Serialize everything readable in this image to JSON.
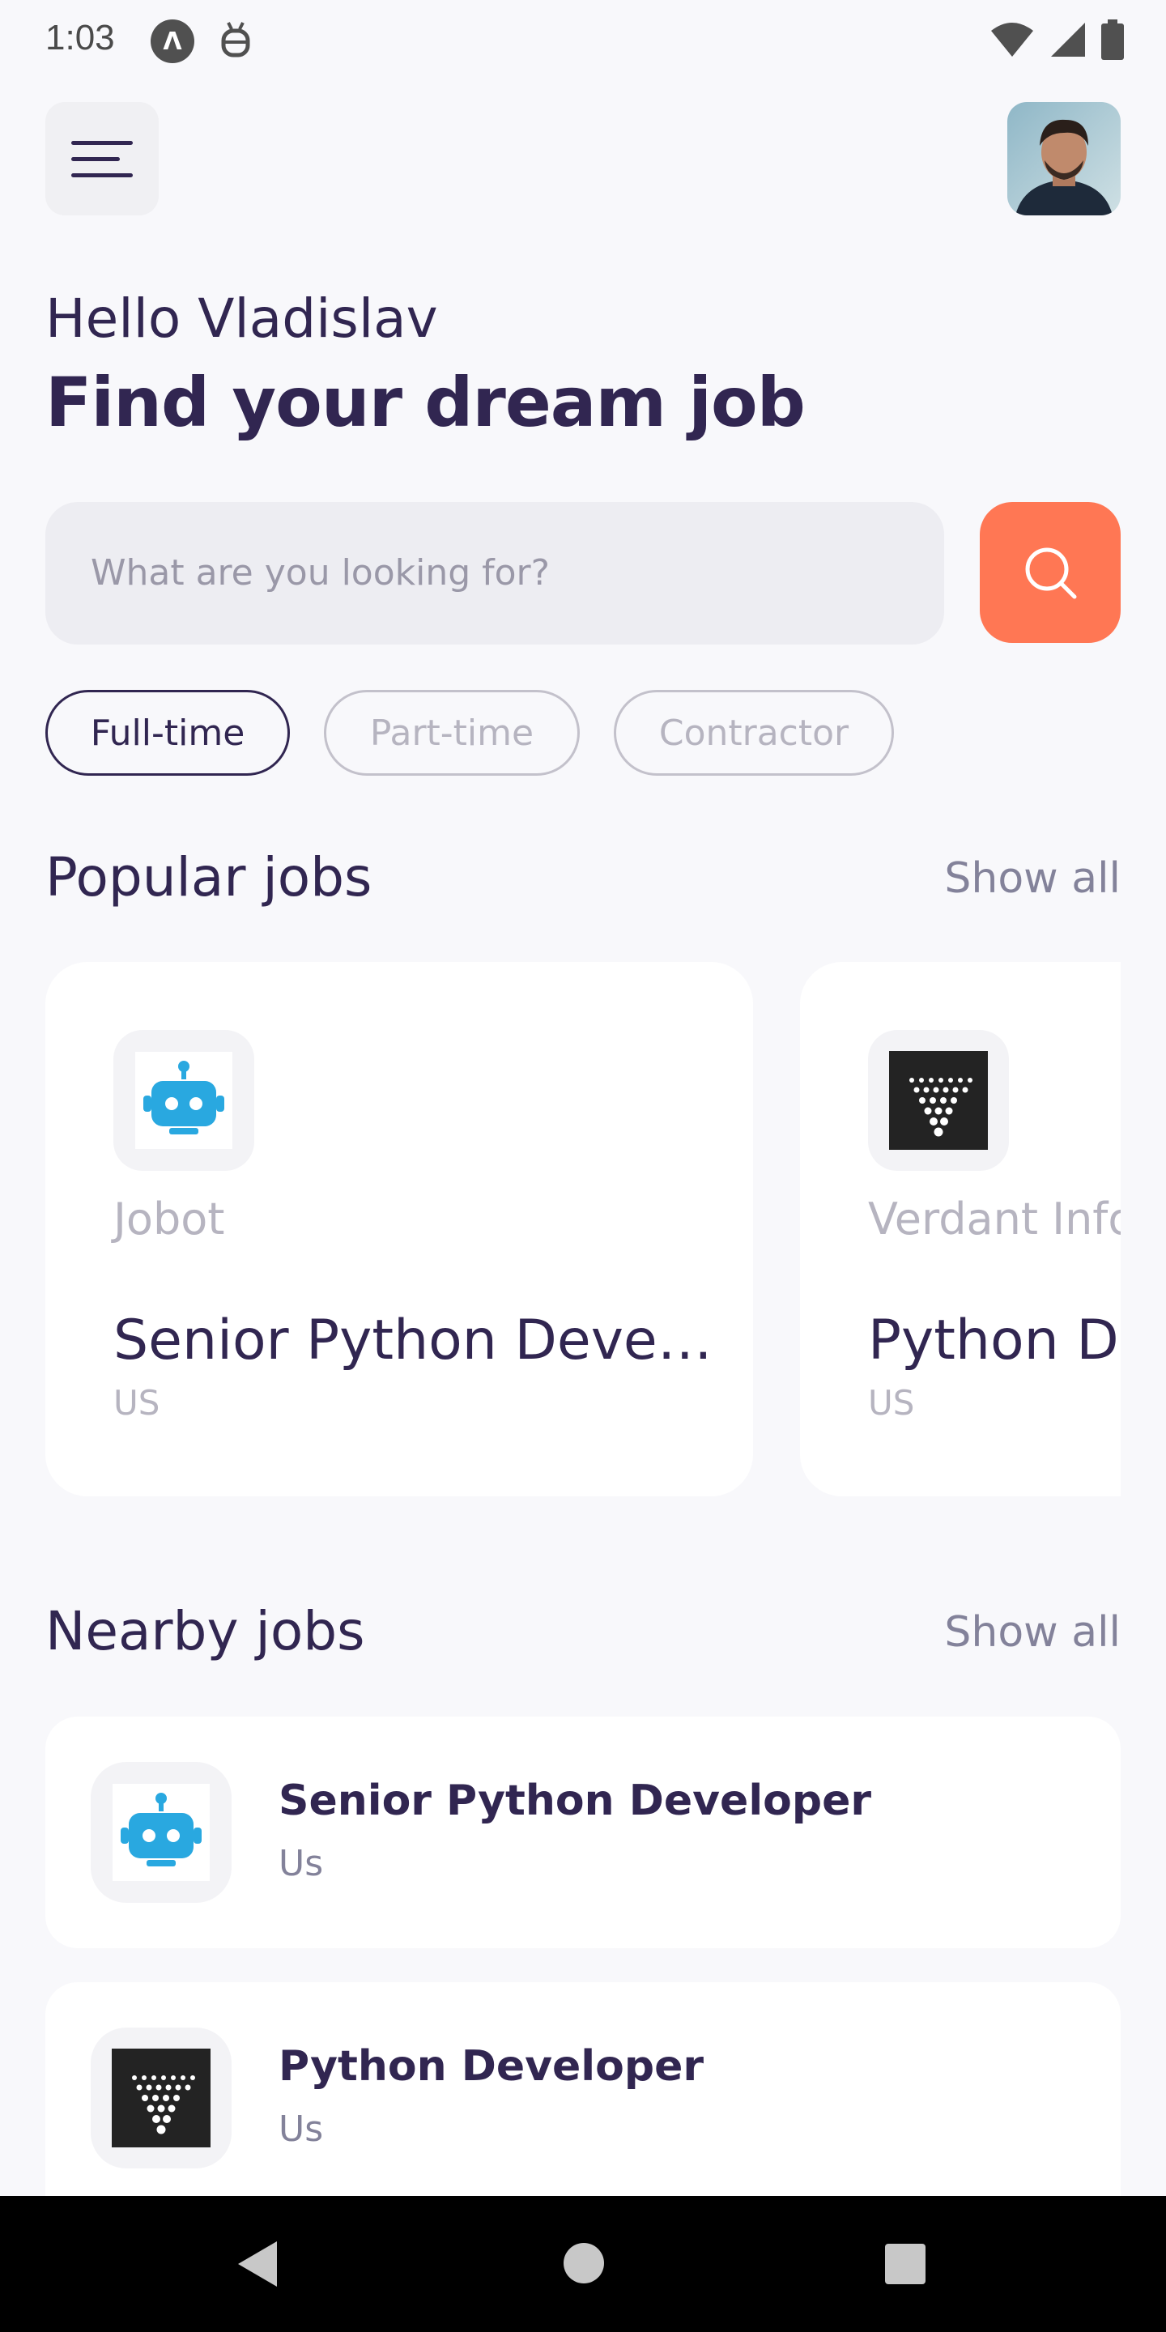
{
  "status_bar": {
    "time": "1:03",
    "app_icon_letter": "Λ"
  },
  "greeting": "Hello Vladislav",
  "headline": "Find your dream job",
  "search": {
    "placeholder": "What are you looking for?"
  },
  "job_types": [
    {
      "label": "Full-time",
      "active": true
    },
    {
      "label": "Part-time",
      "active": false
    },
    {
      "label": "Contractor",
      "active": false
    }
  ],
  "popular": {
    "title": "Popular jobs",
    "show_all": "Show all",
    "cards": [
      {
        "company": "Jobot",
        "title": "Senior Python Deve…",
        "location": "US",
        "logo": "robot-icon"
      },
      {
        "company": "Verdant Info",
        "title": "Python De",
        "location": "US",
        "logo": "triangle-dots-icon"
      }
    ]
  },
  "nearby": {
    "title": "Nearby jobs",
    "show_all": "Show all",
    "items": [
      {
        "title": "Senior Python Developer",
        "location": "Us",
        "logo": "robot-icon"
      },
      {
        "title": "Python Developer",
        "location": "Us",
        "logo": "triangle-dots-icon"
      }
    ]
  },
  "colors": {
    "primary": "#312651",
    "accent": "#ff7754",
    "gray": "#83829a",
    "light_gray": "#b6b4c0",
    "background": "#f8f8fb"
  }
}
